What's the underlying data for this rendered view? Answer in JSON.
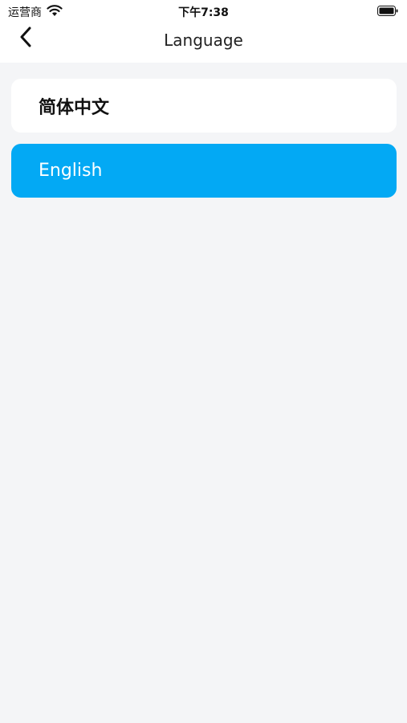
{
  "status_bar": {
    "carrier": "运营商",
    "time": "下午7:38",
    "icons": [
      "wifi-icon",
      "battery-icon"
    ]
  },
  "nav": {
    "title": "Language",
    "back_icon": "chevron-left-icon"
  },
  "languages": [
    {
      "label": "简体中文",
      "selected": false
    },
    {
      "label": "English",
      "selected": true
    }
  ],
  "colors": {
    "accent": "#03a9f4",
    "background": "#f4f5f7",
    "card": "#ffffff"
  }
}
